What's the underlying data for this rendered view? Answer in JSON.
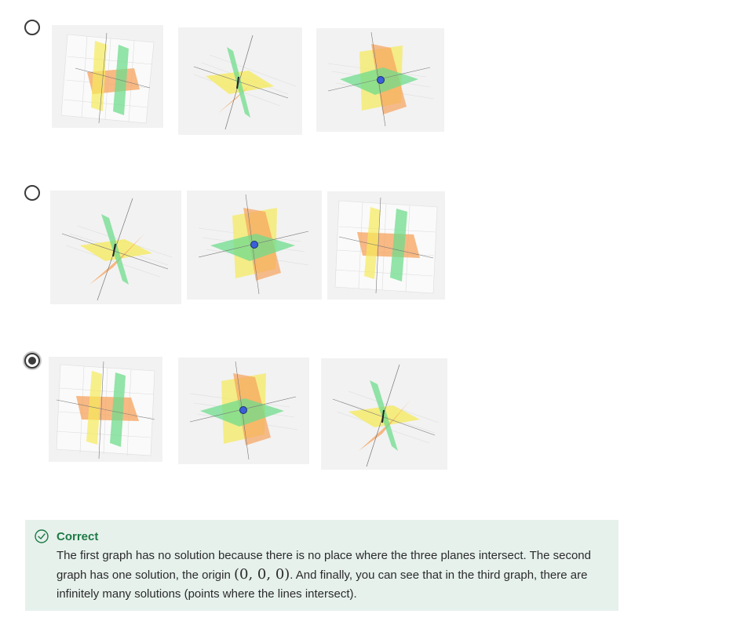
{
  "options": [
    {
      "id": "option-1",
      "selected": false,
      "graphs": [
        "parallel-no-solution",
        "line-infinite",
        "point-one-solution"
      ]
    },
    {
      "id": "option-2",
      "selected": false,
      "graphs": [
        "line-infinite",
        "point-one-solution",
        "parallel-no-solution"
      ]
    },
    {
      "id": "option-3",
      "selected": true,
      "graphs": [
        "parallel-no-solution",
        "point-one-solution",
        "line-infinite"
      ]
    }
  ],
  "feedback": {
    "status": "Correct",
    "text_part1": "The first graph has no solution because there is no place where the three planes intersect. The second graph has one solution, the origin ",
    "math": "(0, 0, 0)",
    "text_part2": ". And finally, you can see that in the third graph, there are infinitely many solutions (points where the lines intersect).",
    "accent_color": "#1e7a46",
    "background_color": "#e6f1ec"
  },
  "colors": {
    "plane_yellow": "#f5ea5a",
    "plane_orange": "#f7a35c",
    "plane_green": "#6fdc8c",
    "point_blue": "#3a5fd9"
  }
}
